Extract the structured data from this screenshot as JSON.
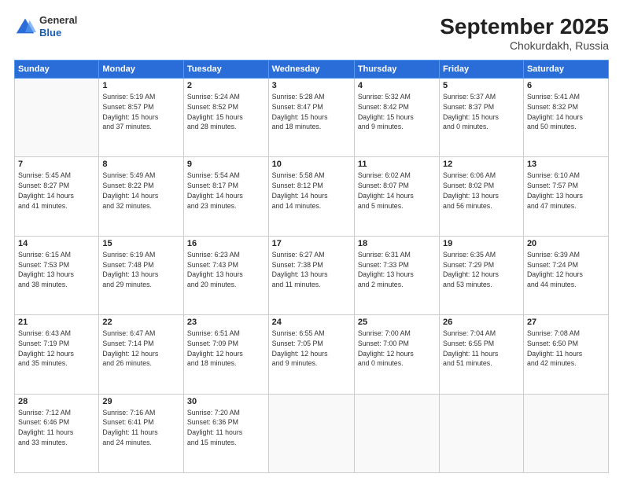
{
  "header": {
    "logo": {
      "general": "General",
      "blue": "Blue"
    },
    "title": "September 2025",
    "location": "Chokurdakh, Russia"
  },
  "weekdays": [
    "Sunday",
    "Monday",
    "Tuesday",
    "Wednesday",
    "Thursday",
    "Friday",
    "Saturday"
  ],
  "weeks": [
    [
      {
        "day": "",
        "info": ""
      },
      {
        "day": "1",
        "info": "Sunrise: 5:19 AM\nSunset: 8:57 PM\nDaylight: 15 hours\nand 37 minutes."
      },
      {
        "day": "2",
        "info": "Sunrise: 5:24 AM\nSunset: 8:52 PM\nDaylight: 15 hours\nand 28 minutes."
      },
      {
        "day": "3",
        "info": "Sunrise: 5:28 AM\nSunset: 8:47 PM\nDaylight: 15 hours\nand 18 minutes."
      },
      {
        "day": "4",
        "info": "Sunrise: 5:32 AM\nSunset: 8:42 PM\nDaylight: 15 hours\nand 9 minutes."
      },
      {
        "day": "5",
        "info": "Sunrise: 5:37 AM\nSunset: 8:37 PM\nDaylight: 15 hours\nand 0 minutes."
      },
      {
        "day": "6",
        "info": "Sunrise: 5:41 AM\nSunset: 8:32 PM\nDaylight: 14 hours\nand 50 minutes."
      }
    ],
    [
      {
        "day": "7",
        "info": "Sunrise: 5:45 AM\nSunset: 8:27 PM\nDaylight: 14 hours\nand 41 minutes."
      },
      {
        "day": "8",
        "info": "Sunrise: 5:49 AM\nSunset: 8:22 PM\nDaylight: 14 hours\nand 32 minutes."
      },
      {
        "day": "9",
        "info": "Sunrise: 5:54 AM\nSunset: 8:17 PM\nDaylight: 14 hours\nand 23 minutes."
      },
      {
        "day": "10",
        "info": "Sunrise: 5:58 AM\nSunset: 8:12 PM\nDaylight: 14 hours\nand 14 minutes."
      },
      {
        "day": "11",
        "info": "Sunrise: 6:02 AM\nSunset: 8:07 PM\nDaylight: 14 hours\nand 5 minutes."
      },
      {
        "day": "12",
        "info": "Sunrise: 6:06 AM\nSunset: 8:02 PM\nDaylight: 13 hours\nand 56 minutes."
      },
      {
        "day": "13",
        "info": "Sunrise: 6:10 AM\nSunset: 7:57 PM\nDaylight: 13 hours\nand 47 minutes."
      }
    ],
    [
      {
        "day": "14",
        "info": "Sunrise: 6:15 AM\nSunset: 7:53 PM\nDaylight: 13 hours\nand 38 minutes."
      },
      {
        "day": "15",
        "info": "Sunrise: 6:19 AM\nSunset: 7:48 PM\nDaylight: 13 hours\nand 29 minutes."
      },
      {
        "day": "16",
        "info": "Sunrise: 6:23 AM\nSunset: 7:43 PM\nDaylight: 13 hours\nand 20 minutes."
      },
      {
        "day": "17",
        "info": "Sunrise: 6:27 AM\nSunset: 7:38 PM\nDaylight: 13 hours\nand 11 minutes."
      },
      {
        "day": "18",
        "info": "Sunrise: 6:31 AM\nSunset: 7:33 PM\nDaylight: 13 hours\nand 2 minutes."
      },
      {
        "day": "19",
        "info": "Sunrise: 6:35 AM\nSunset: 7:29 PM\nDaylight: 12 hours\nand 53 minutes."
      },
      {
        "day": "20",
        "info": "Sunrise: 6:39 AM\nSunset: 7:24 PM\nDaylight: 12 hours\nand 44 minutes."
      }
    ],
    [
      {
        "day": "21",
        "info": "Sunrise: 6:43 AM\nSunset: 7:19 PM\nDaylight: 12 hours\nand 35 minutes."
      },
      {
        "day": "22",
        "info": "Sunrise: 6:47 AM\nSunset: 7:14 PM\nDaylight: 12 hours\nand 26 minutes."
      },
      {
        "day": "23",
        "info": "Sunrise: 6:51 AM\nSunset: 7:09 PM\nDaylight: 12 hours\nand 18 minutes."
      },
      {
        "day": "24",
        "info": "Sunrise: 6:55 AM\nSunset: 7:05 PM\nDaylight: 12 hours\nand 9 minutes."
      },
      {
        "day": "25",
        "info": "Sunrise: 7:00 AM\nSunset: 7:00 PM\nDaylight: 12 hours\nand 0 minutes."
      },
      {
        "day": "26",
        "info": "Sunrise: 7:04 AM\nSunset: 6:55 PM\nDaylight: 11 hours\nand 51 minutes."
      },
      {
        "day": "27",
        "info": "Sunrise: 7:08 AM\nSunset: 6:50 PM\nDaylight: 11 hours\nand 42 minutes."
      }
    ],
    [
      {
        "day": "28",
        "info": "Sunrise: 7:12 AM\nSunset: 6:46 PM\nDaylight: 11 hours\nand 33 minutes."
      },
      {
        "day": "29",
        "info": "Sunrise: 7:16 AM\nSunset: 6:41 PM\nDaylight: 11 hours\nand 24 minutes."
      },
      {
        "day": "30",
        "info": "Sunrise: 7:20 AM\nSunset: 6:36 PM\nDaylight: 11 hours\nand 15 minutes."
      },
      {
        "day": "",
        "info": ""
      },
      {
        "day": "",
        "info": ""
      },
      {
        "day": "",
        "info": ""
      },
      {
        "day": "",
        "info": ""
      }
    ]
  ]
}
